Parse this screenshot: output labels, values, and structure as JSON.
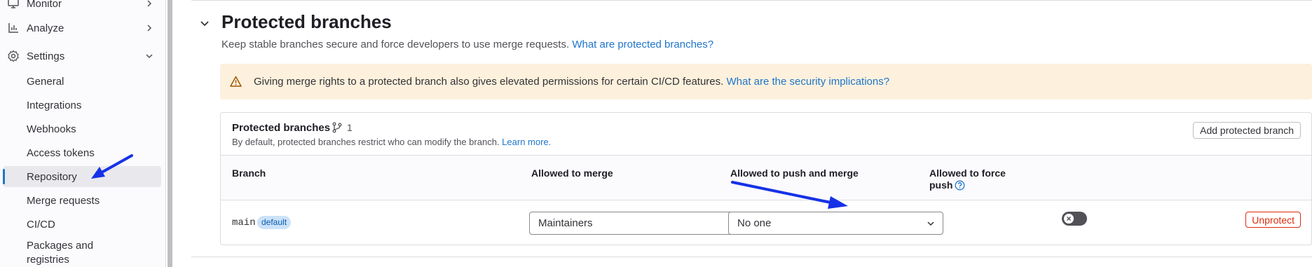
{
  "sidebar": {
    "top_items": [
      {
        "label": "Monitor",
        "icon": "monitor-icon"
      },
      {
        "label": "Analyze",
        "icon": "chart-icon"
      },
      {
        "label": "Settings",
        "icon": "settings-icon"
      }
    ],
    "settings_items": [
      {
        "label": "General"
      },
      {
        "label": "Integrations"
      },
      {
        "label": "Webhooks"
      },
      {
        "label": "Access tokens"
      },
      {
        "label": "Repository",
        "active": true
      },
      {
        "label": "Merge requests"
      },
      {
        "label": "CI/CD"
      },
      {
        "label": "Packages and registries"
      }
    ]
  },
  "section": {
    "title": "Protected branches",
    "description": "Keep stable branches secure and force developers to use merge requests.",
    "description_link": "What are protected branches?"
  },
  "alert": {
    "icon": "warning-icon",
    "text": "Giving merge rights to a protected branch also gives elevated permissions for certain CI/CD features.",
    "link": "What are the security implications?"
  },
  "card": {
    "title": "Protected branches",
    "branch_count": "1",
    "description": "By default, protected branches restrict who can modify the branch.",
    "description_link": "Learn more.",
    "add_button": "Add protected branch"
  },
  "table": {
    "headers": {
      "branch": "Branch",
      "merge": "Allowed to merge",
      "push_merge": "Allowed to push and merge",
      "force_push_line1": "Allowed to force",
      "force_push_line2": "push"
    },
    "rows": [
      {
        "branch": "main",
        "badge": "default",
        "merge": "Maintainers",
        "push_merge": "No one",
        "force_push": false,
        "action": "Unprotect"
      }
    ]
  },
  "colors": {
    "link": "#1f75cb",
    "alert_bg": "#fdf1dd",
    "danger": "#dd2b0e",
    "annotation_arrow": "#1632e6"
  }
}
